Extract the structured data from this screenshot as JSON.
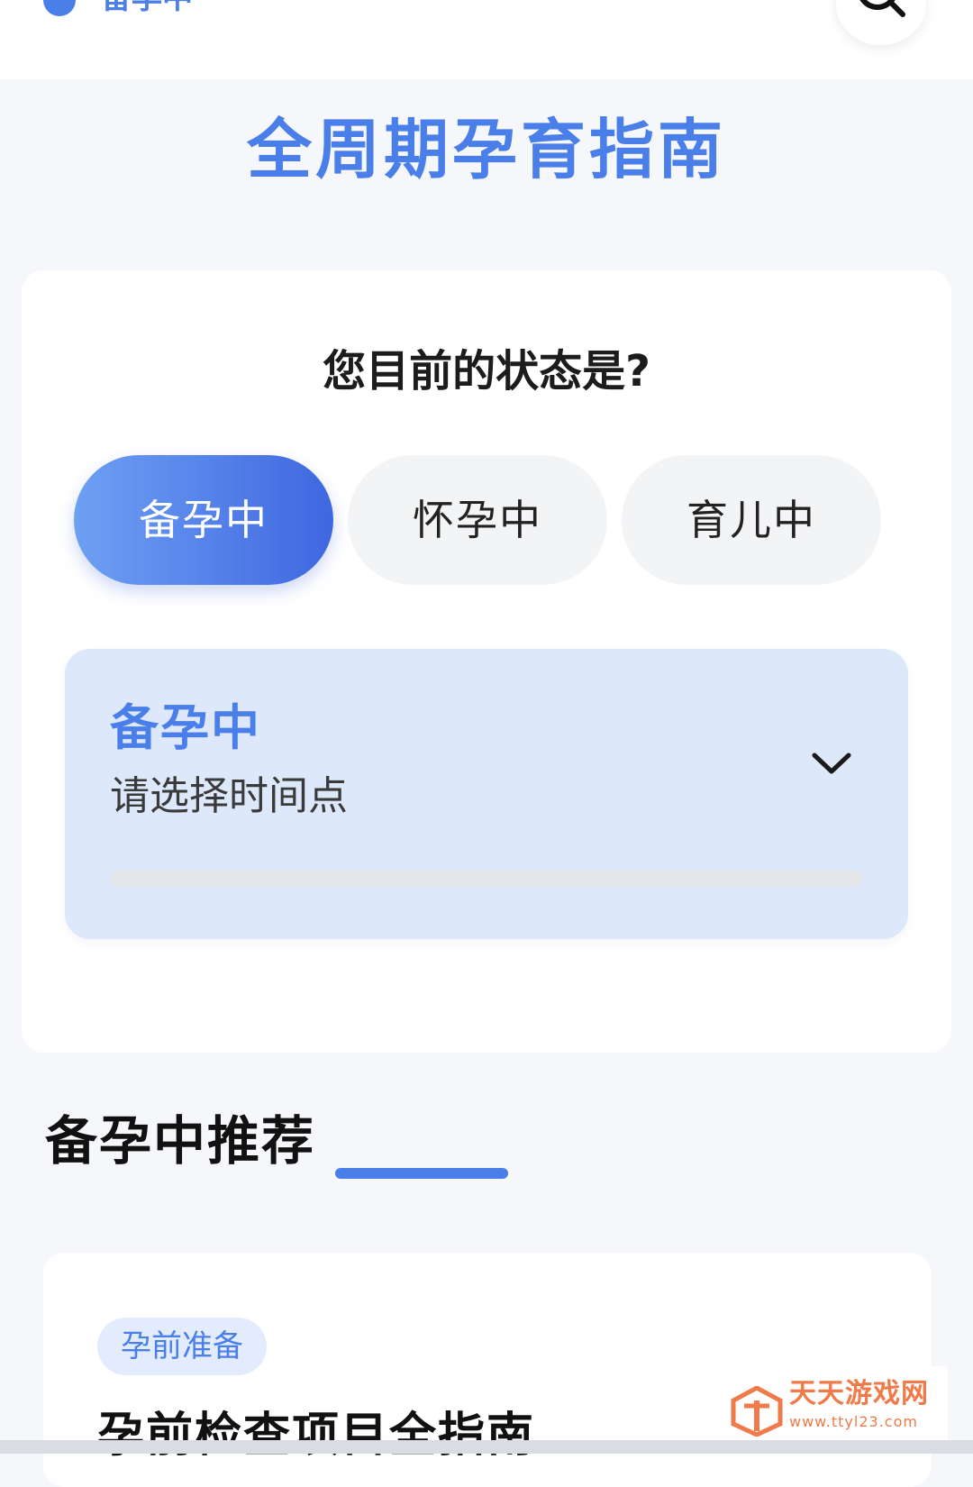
{
  "topbar": {
    "stage_label": "备孕中",
    "icon": "search-icon"
  },
  "page": {
    "title": "全周期孕育指南"
  },
  "status": {
    "question": "您目前的状态是?",
    "options": [
      "备孕中",
      "怀孕中",
      "育儿中"
    ],
    "selected": "备孕中"
  },
  "picker": {
    "stage": "备孕中",
    "hint": "请选择时间点",
    "icon": "chevron-down-icon",
    "progress": 0
  },
  "recommend": {
    "title": "备孕中推荐",
    "card": {
      "tag": "孕前准备",
      "title": "孕前检查项目全指南"
    }
  },
  "watermark": {
    "name": "天天游戏网",
    "url": "www.ttyl23.com"
  },
  "colors": {
    "accent": "#4a7ee8",
    "background": "#f5f7fb",
    "picker_bg": "#dde8fb",
    "watermark": "#f07a4a"
  }
}
